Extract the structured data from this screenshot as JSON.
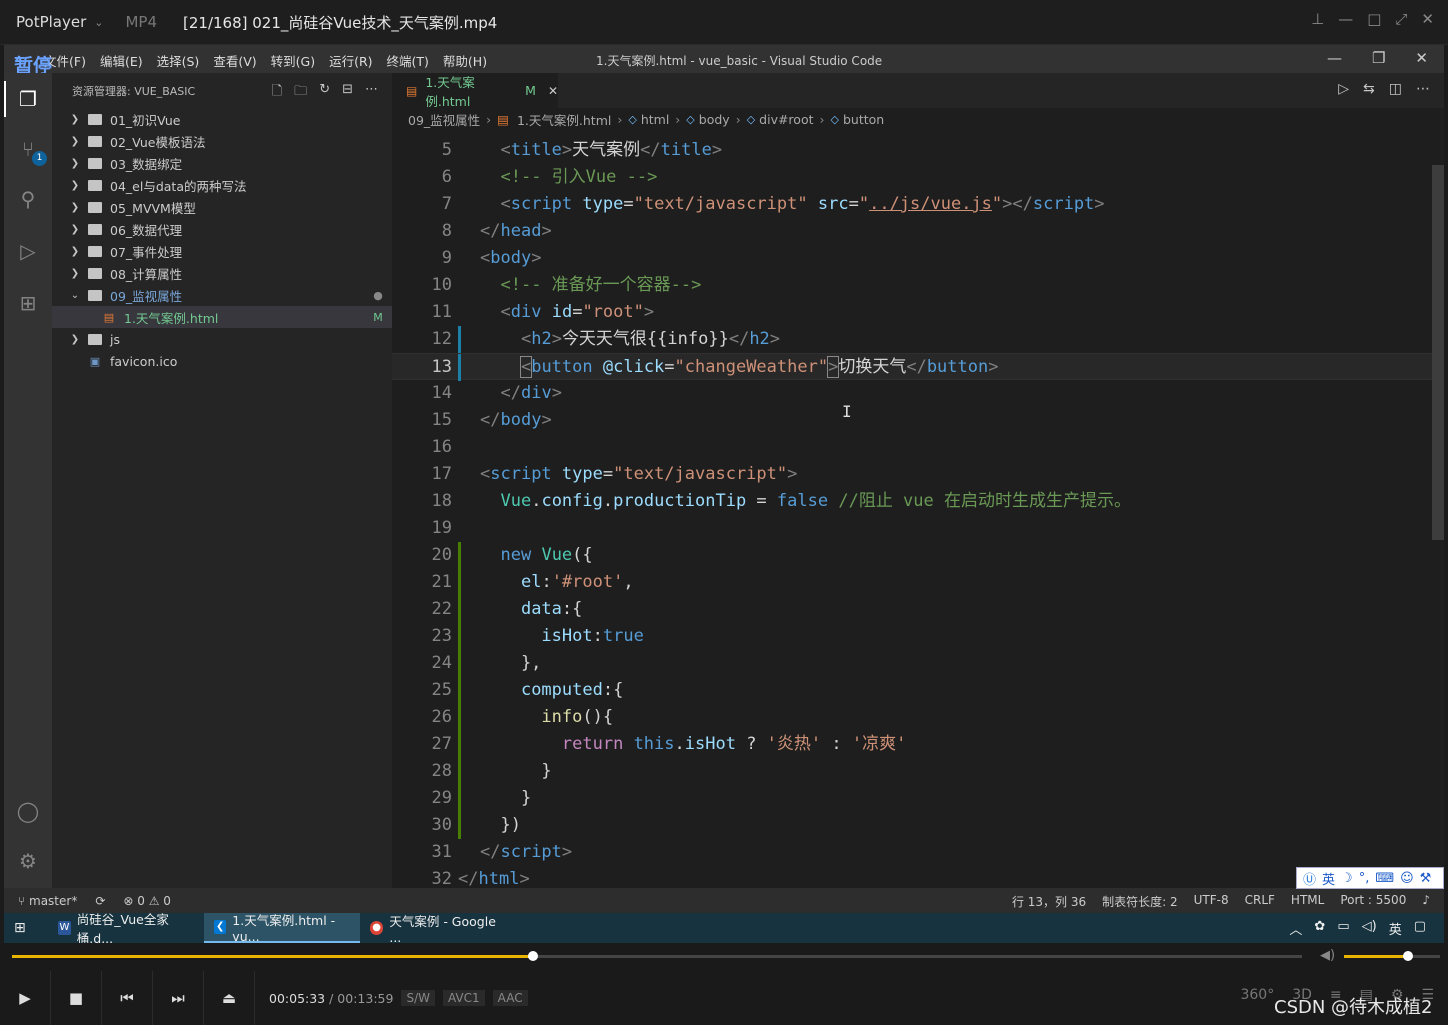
{
  "player": {
    "brand": "PotPlayer",
    "format": "MP4",
    "file_title": "[21/168] 021_尚硅谷Vue技术_天气案例.mp4",
    "time_current": "00:05:33",
    "time_total": "/ 00:13:59",
    "tags": [
      "S/W",
      "AVC1",
      "AAC"
    ],
    "progress": 0.404,
    "volume": 0.67,
    "right_buttons": [
      "360°",
      "3D"
    ],
    "watermark": "CSDN @待木成植2"
  },
  "vscode": {
    "pause_label": "暂停",
    "menu": [
      "文件(F)",
      "编辑(E)",
      "选择(S)",
      "查看(V)",
      "转到(G)",
      "运行(R)",
      "终端(T)",
      "帮助(H)"
    ],
    "window_title": "1.天气案例.html - vue_basic - Visual Studio Code",
    "scm_badge": "1",
    "explorer_title": "资源管理器: VUE_BASIC",
    "tree": [
      {
        "name": "01_初识Vue",
        "type": "folder"
      },
      {
        "name": "02_Vue模板语法",
        "type": "folder"
      },
      {
        "name": "03_数据绑定",
        "type": "folder"
      },
      {
        "name": "04_el与data的两种写法",
        "type": "folder"
      },
      {
        "name": "05_MVVM模型",
        "type": "folder"
      },
      {
        "name": "06_数据代理",
        "type": "folder"
      },
      {
        "name": "07_事件处理",
        "type": "folder"
      },
      {
        "name": "08_计算属性",
        "type": "folder"
      },
      {
        "name": "09_监视属性",
        "type": "folder-open",
        "decoration": "●"
      },
      {
        "name": "1.天气案例.html",
        "type": "html",
        "decoration": "M"
      },
      {
        "name": "js",
        "type": "folder"
      },
      {
        "name": "favicon.ico",
        "type": "file"
      }
    ],
    "tab": {
      "label": "1.天气案例.html",
      "modified": "M"
    },
    "breadcrumbs": [
      "09_监视属性",
      "1.天气案例.html",
      "html",
      "body",
      "div#root",
      "button"
    ],
    "code_lines": [
      {
        "n": "5",
        "g": ""
      },
      {
        "n": "6",
        "g": ""
      },
      {
        "n": "7",
        "g": ""
      },
      {
        "n": "8",
        "g": ""
      },
      {
        "n": "9",
        "g": ""
      },
      {
        "n": "10",
        "g": ""
      },
      {
        "n": "11",
        "g": ""
      },
      {
        "n": "12",
        "g": "mod"
      },
      {
        "n": "13",
        "g": "mod"
      },
      {
        "n": "14",
        "g": ""
      },
      {
        "n": "15",
        "g": ""
      },
      {
        "n": "16",
        "g": ""
      },
      {
        "n": "17",
        "g": ""
      },
      {
        "n": "18",
        "g": ""
      },
      {
        "n": "19",
        "g": ""
      },
      {
        "n": "20",
        "g": "add"
      },
      {
        "n": "21",
        "g": "add"
      },
      {
        "n": "22",
        "g": "add"
      },
      {
        "n": "23",
        "g": "add"
      },
      {
        "n": "24",
        "g": "add"
      },
      {
        "n": "25",
        "g": "add"
      },
      {
        "n": "26",
        "g": "add"
      },
      {
        "n": "27",
        "g": "add"
      },
      {
        "n": "28",
        "g": "add"
      },
      {
        "n": "29",
        "g": "add"
      },
      {
        "n": "30",
        "g": "add"
      },
      {
        "n": "31",
        "g": ""
      },
      {
        "n": "32",
        "g": ""
      }
    ],
    "status": {
      "branch": "master*",
      "problems": "⊗ 0 ⚠ 0",
      "position": "行 13，列 36",
      "tab_size": "制表符长度: 2",
      "encoding": "UTF-8",
      "eol": "CRLF",
      "language": "HTML",
      "port": "Port : 5500"
    },
    "ime": "英"
  },
  "taskbar": {
    "items": [
      {
        "label": "尚硅谷_Vue全家桶.d...",
        "icon": "W"
      },
      {
        "label": "1.天气案例.html - vu...",
        "icon": "VS"
      },
      {
        "label": "天气案例 - Google ...",
        "icon": "G"
      }
    ],
    "ime": "英"
  },
  "colors": {
    "accent_yellow": "#e8b400",
    "vscode_bg": "#1e1e1e",
    "modified_green": "#73c991"
  }
}
